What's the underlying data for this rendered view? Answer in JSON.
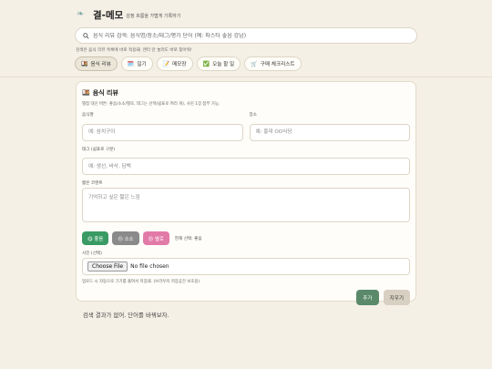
{
  "header": {
    "title": "결-메모",
    "subtitle": "감정 흐름을 가볍게 기록하기",
    "logo_icon": "leaf-icon"
  },
  "search": {
    "placeholder": "음식 리뷰 검색: 음식명/장소/태그/평가 단어 (예: 파스타 좋음 강남)",
    "value": ""
  },
  "hint": "검색은 음식 리뷰 목록에 바로 적용돼. 엔터 안 눌러도 바로 찾아줘!",
  "tabs": [
    {
      "icon": "🍱",
      "label": "음식 리뷰",
      "active": true
    },
    {
      "icon": "🗓️",
      "label": "일기",
      "active": false
    },
    {
      "icon": "📝",
      "label": "메모장",
      "active": false
    },
    {
      "icon": "✅",
      "label": "오늘 할 일",
      "active": false
    },
    {
      "icon": "🛒",
      "label": "구매 체크리스트",
      "active": false
    }
  ],
  "card": {
    "icon": "🍱",
    "title": "음식 리뷰",
    "description": "별점 대신 버튼: 좋음/소소/별로, 태그는 선택(쉼표로 여러 개), 사진 1장 첨부 가능.",
    "fields": {
      "name_label": "음식명",
      "name_placeholder": "예: 삼치구이",
      "place_label": "장소",
      "place_placeholder": "예: 홍대 OO식당",
      "tags_label": "태그 (쉼표로 구분)",
      "tags_placeholder": "예: 생선, 바삭, 담백",
      "comment_label": "짧은 코멘트",
      "comment_placeholder": "기억하고 싶은 짧은 느낌"
    },
    "moods": [
      {
        "key": "good",
        "label": "😋 좋음"
      },
      {
        "key": "soso",
        "label": "😐 소소"
      },
      {
        "key": "bad",
        "label": "😣 별로"
      }
    ],
    "mood_status": "현재 선택: 좋음",
    "photo_label": "사진 (선택)",
    "file_button": "Choose File",
    "file_name": "No file chosen",
    "photo_note": "업로드 시 자동으로 크기를 줄여서 저장돼. (브라우저 저장공간 보호용)",
    "add_button": "추가",
    "clear_button": "지우기",
    "empty_message": "검색 결과가 없어. 단어를 바꿔보자."
  }
}
